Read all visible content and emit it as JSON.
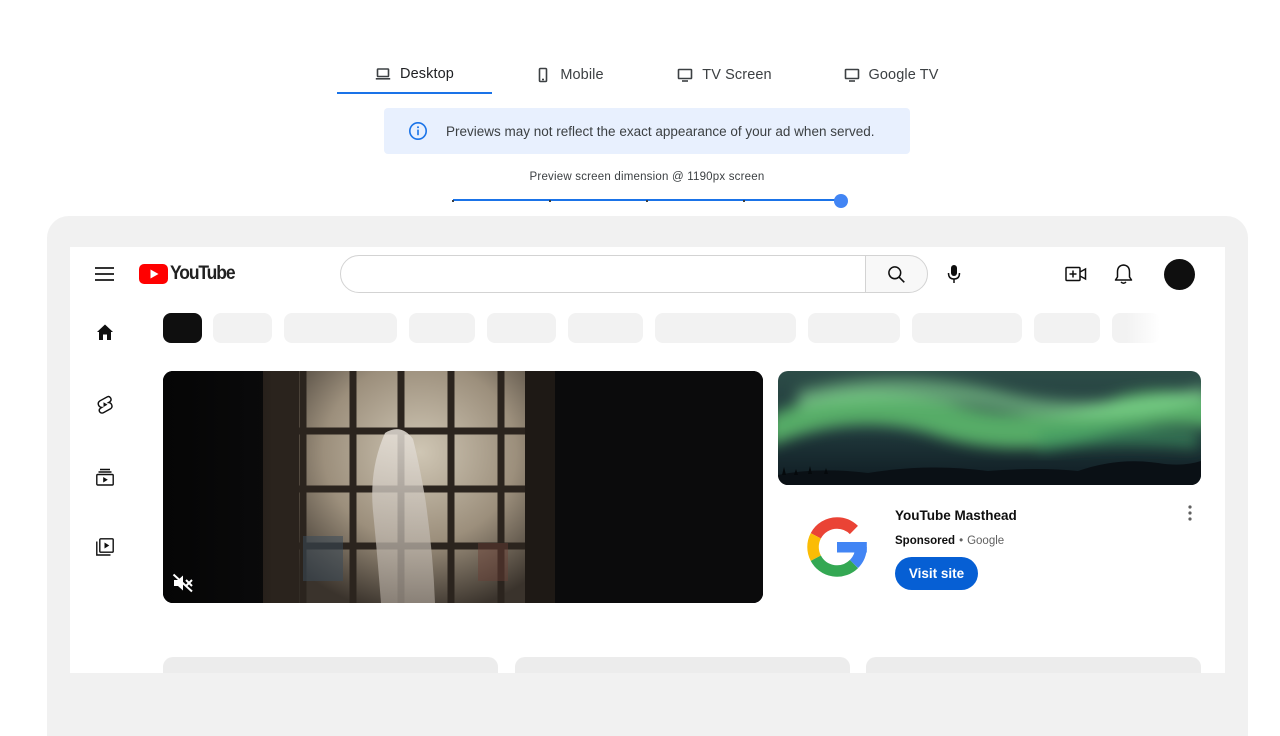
{
  "tabs": [
    {
      "label": "Desktop",
      "icon": "laptop-icon",
      "active": true
    },
    {
      "label": "Mobile",
      "icon": "phone-icon",
      "active": false
    },
    {
      "label": "TV Screen",
      "icon": "tv-icon",
      "active": false
    },
    {
      "label": "Google TV",
      "icon": "tv-icon",
      "active": false
    }
  ],
  "banner": {
    "icon": "info-icon",
    "text": "Previews may not reflect the exact appearance of your ad when served."
  },
  "preview_dimension": {
    "label": "Preview screen dimension @ 1190px screen",
    "steps": 5,
    "selected_step": 4
  },
  "youtube": {
    "wordmark": "YouTube",
    "search": {
      "value": "",
      "placeholder": ""
    },
    "header_icons": [
      "menu-icon",
      "search-icon",
      "mic-icon",
      "create-video-icon",
      "bell-icon",
      "avatar"
    ],
    "sidebar_icons": [
      "home-icon",
      "shorts-icon",
      "subscriptions-icon",
      "library-icon"
    ],
    "chips": {
      "count": 11,
      "active_index": 0
    }
  },
  "masthead": {
    "title": "YouTube Masthead",
    "sponsored": "Sponsored",
    "separator": "•",
    "advertiser": "Google",
    "cta": "Visit site",
    "video_muted": true
  },
  "colors": {
    "accent": "#1a73e8",
    "youtube_red": "#ff0000",
    "cta_blue": "#065fd4",
    "banner_bg": "#e8f0fe"
  }
}
